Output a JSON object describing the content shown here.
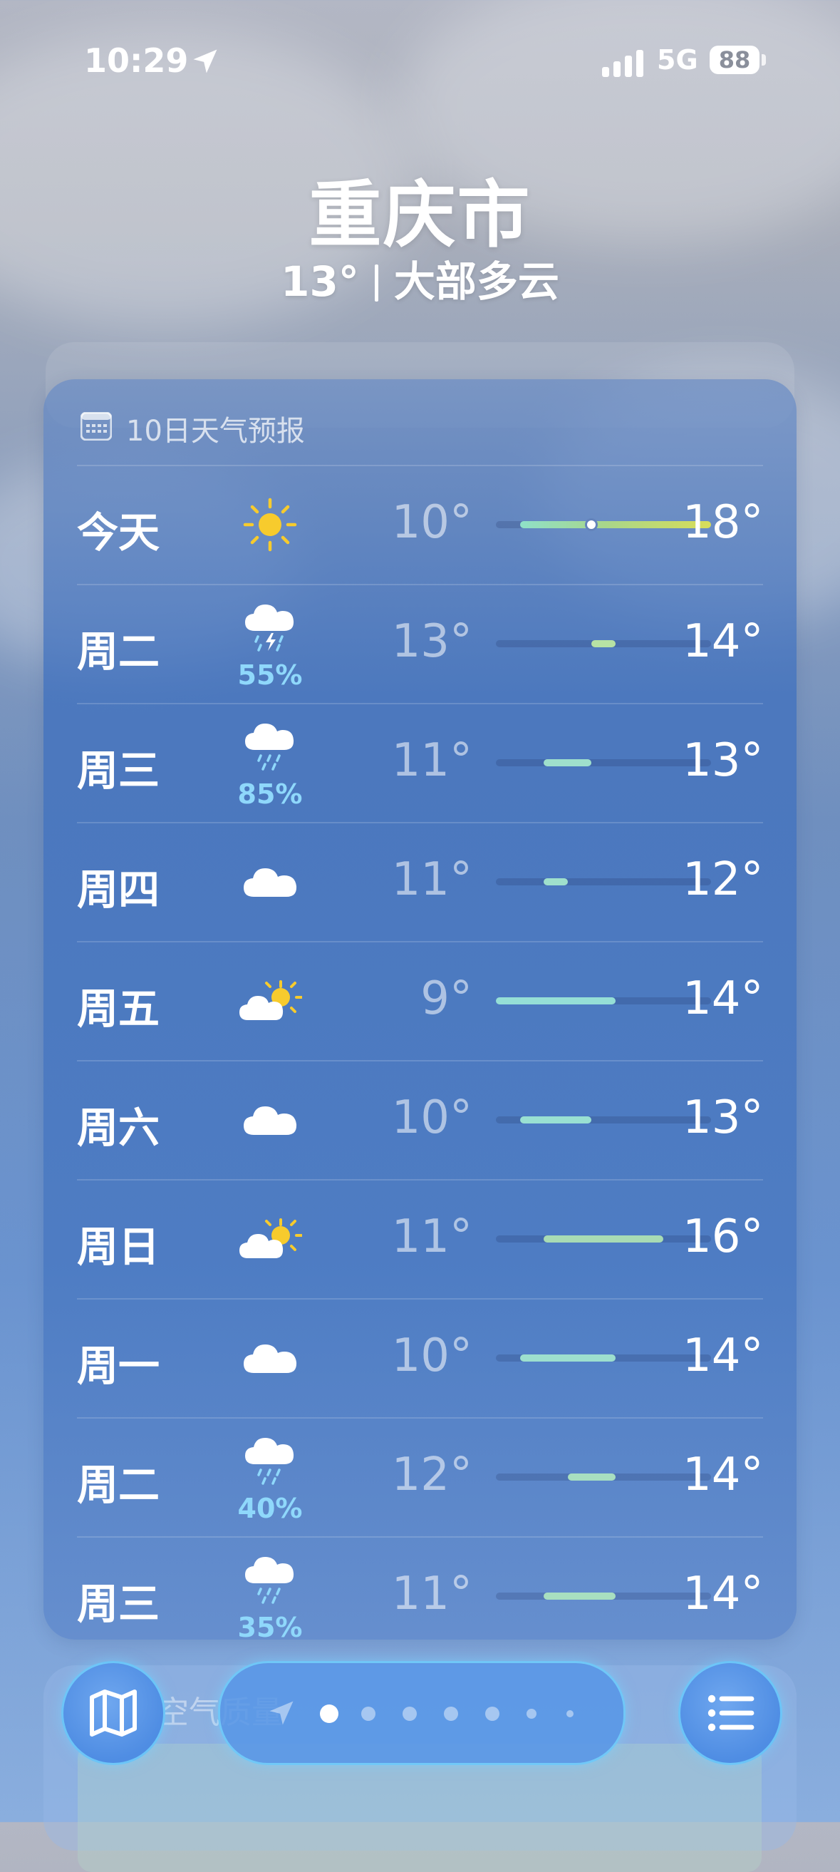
{
  "status_bar": {
    "time": "10:29",
    "network": "5G",
    "battery": "88"
  },
  "header": {
    "city": "重庆市",
    "temp": "13°",
    "condition": "大部多云"
  },
  "air_quality_peek": {
    "label": "空气质量"
  },
  "forecast": {
    "title": "10日天气预报",
    "rows": [
      {
        "day": "今天",
        "icon": "sun-icon",
        "precip": "",
        "low": "10°",
        "high": "18°",
        "range": [
          10,
          18
        ],
        "current": 13,
        "bar_color": "#a9d68a"
      },
      {
        "day": "周二",
        "icon": "thunderstorm-icon",
        "precip": "55%",
        "low": "13°",
        "high": "14°",
        "range": [
          13,
          14
        ],
        "bar_color": "#b7e2a4"
      },
      {
        "day": "周三",
        "icon": "rain-icon",
        "precip": "85%",
        "low": "11°",
        "high": "13°",
        "range": [
          11,
          13
        ],
        "bar_color": "#9fe0cc"
      },
      {
        "day": "周四",
        "icon": "cloud-icon",
        "precip": "",
        "low": "11°",
        "high": "12°",
        "range": [
          11,
          12
        ],
        "bar_color": "#9fe0cc"
      },
      {
        "day": "周五",
        "icon": "partly-sunny-icon",
        "precip": "",
        "low": "9°",
        "high": "14°",
        "range": [
          9,
          14
        ],
        "bar_color": "#95dfd6"
      },
      {
        "day": "周六",
        "icon": "cloud-icon",
        "precip": "",
        "low": "10°",
        "high": "13°",
        "range": [
          10,
          13
        ],
        "bar_color": "#99e0d2"
      },
      {
        "day": "周日",
        "icon": "partly-sunny-icon",
        "precip": "",
        "low": "11°",
        "high": "16°",
        "range": [
          11,
          16
        ],
        "bar_color": "#a8dbb4"
      },
      {
        "day": "周一",
        "icon": "cloud-icon",
        "precip": "",
        "low": "10°",
        "high": "14°",
        "range": [
          10,
          14
        ],
        "bar_color": "#9ddfce"
      },
      {
        "day": "周二",
        "icon": "rain-icon",
        "precip": "40%",
        "low": "12°",
        "high": "14°",
        "range": [
          12,
          14
        ],
        "bar_color": "#a8dfc0"
      },
      {
        "day": "周三",
        "icon": "rain-icon",
        "precip": "35%",
        "low": "11°",
        "high": "14°",
        "range": [
          11,
          14
        ],
        "bar_color": "#a8dfc0"
      }
    ]
  },
  "scale": {
    "min": 9,
    "max": 18
  },
  "pager": {
    "count": 7,
    "active": 0
  },
  "colors": {
    "precip": "#8fd8fb",
    "sun": "#f7cb2d"
  }
}
